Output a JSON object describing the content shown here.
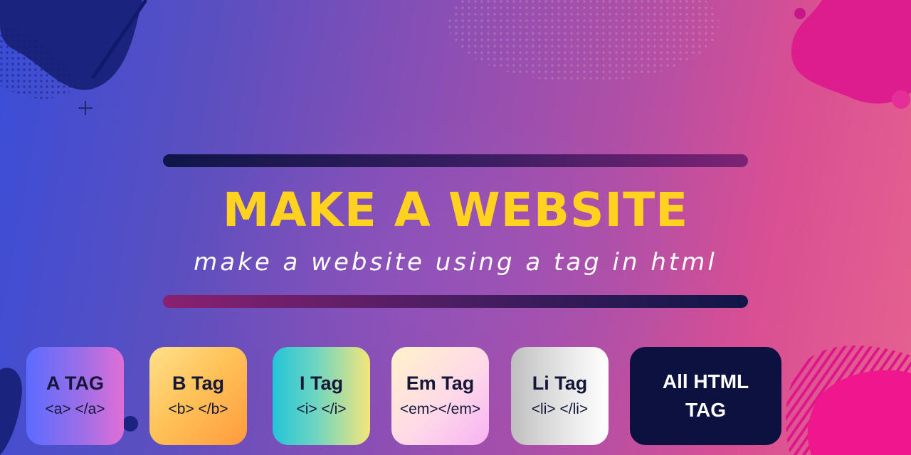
{
  "banner": {
    "title": "MAKE A WEBSITE",
    "subtitle": "make a website using a tag in html"
  },
  "cards": [
    {
      "title": "A TAG",
      "code": "<a> </a>"
    },
    {
      "title": "B Tag",
      "code": "<b> </b>"
    },
    {
      "title": "I Tag",
      "code": "<i> </i>"
    },
    {
      "title": "Em Tag",
      "code": "<em></em>"
    },
    {
      "title": "Li Tag",
      "code": "<li> </li>"
    }
  ],
  "cta": {
    "line1": "All HTML",
    "line2": "TAG"
  },
  "colors": {
    "title": "#ffd21f",
    "subtitle": "#ffffff",
    "dark_card": "#0d1140",
    "card_text": "#14163a"
  }
}
